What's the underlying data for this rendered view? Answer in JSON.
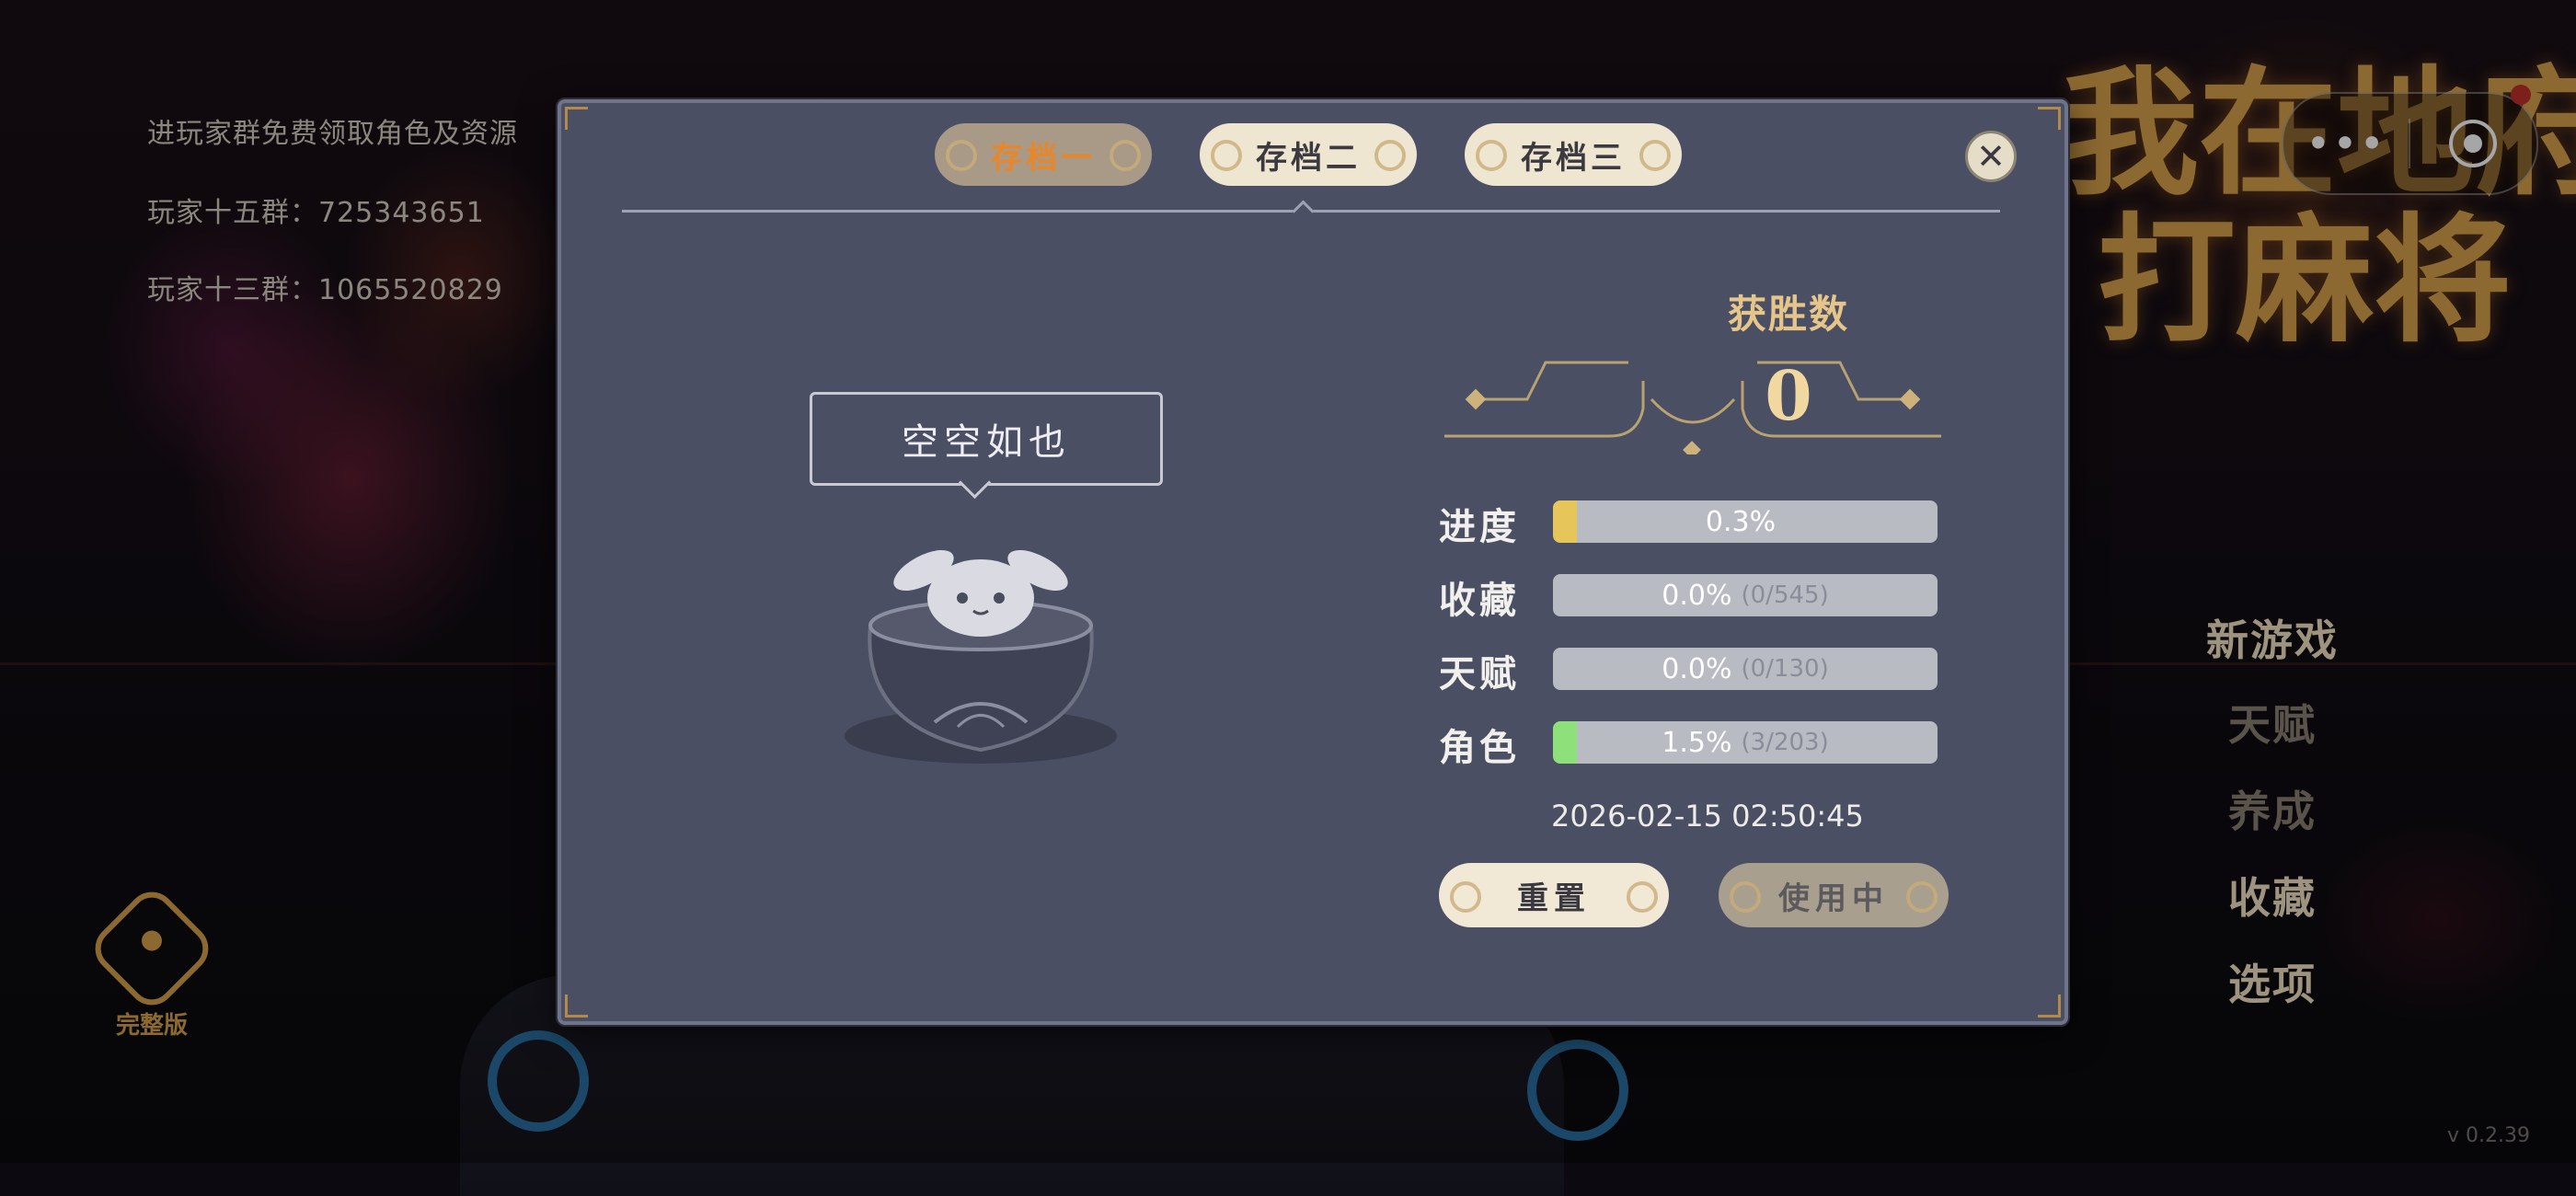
{
  "background": {
    "group_notice": "进玩家群免费领取角色及资源",
    "group_15": "玩家十五群：725343651",
    "group_13": "玩家十三群：1065520829",
    "logo_line1": "我在地府",
    "logo_line2": "打麻将",
    "edition_label": "完整版",
    "version": "v 0.2.39",
    "capsule_more": "•••",
    "menu": {
      "new_game": "新游戏",
      "talent": "天赋",
      "nurture": "养成",
      "collection": "收藏",
      "options": "选项"
    }
  },
  "dialog": {
    "tabs": [
      {
        "label": "存档一",
        "active": true
      },
      {
        "label": "存档二",
        "active": false
      },
      {
        "label": "存档三",
        "active": false
      }
    ],
    "close_symbol": "✕",
    "empty_text": "空空如也",
    "wins_label": "获胜数",
    "wins_value": "0",
    "stats": [
      {
        "label": "进度",
        "value": "0.3%",
        "sub": "",
        "fill": 0.03,
        "color": "#e6c65a"
      },
      {
        "label": "收藏",
        "value": "0.0%",
        "sub": "(0/545)",
        "fill": 0.0,
        "color": "#e6c65a"
      },
      {
        "label": "天赋",
        "value": "0.0%",
        "sub": "(0/130)",
        "fill": 0.0,
        "color": "#e6c65a"
      },
      {
        "label": "角色",
        "value": "1.5%",
        "sub": "(3/203)",
        "fill": 0.015,
        "color": "#8ee07a"
      }
    ],
    "timestamp": "2026-02-15 02:50:45",
    "reset_label": "重置",
    "in_use_label": "使用中"
  },
  "colors": {
    "dialog_bg": "#4b4f63",
    "active_tab_text": "#e8862a",
    "progress_fill": "#e6c65a",
    "role_fill": "#8ee07a",
    "gold": "#d8a24a"
  }
}
